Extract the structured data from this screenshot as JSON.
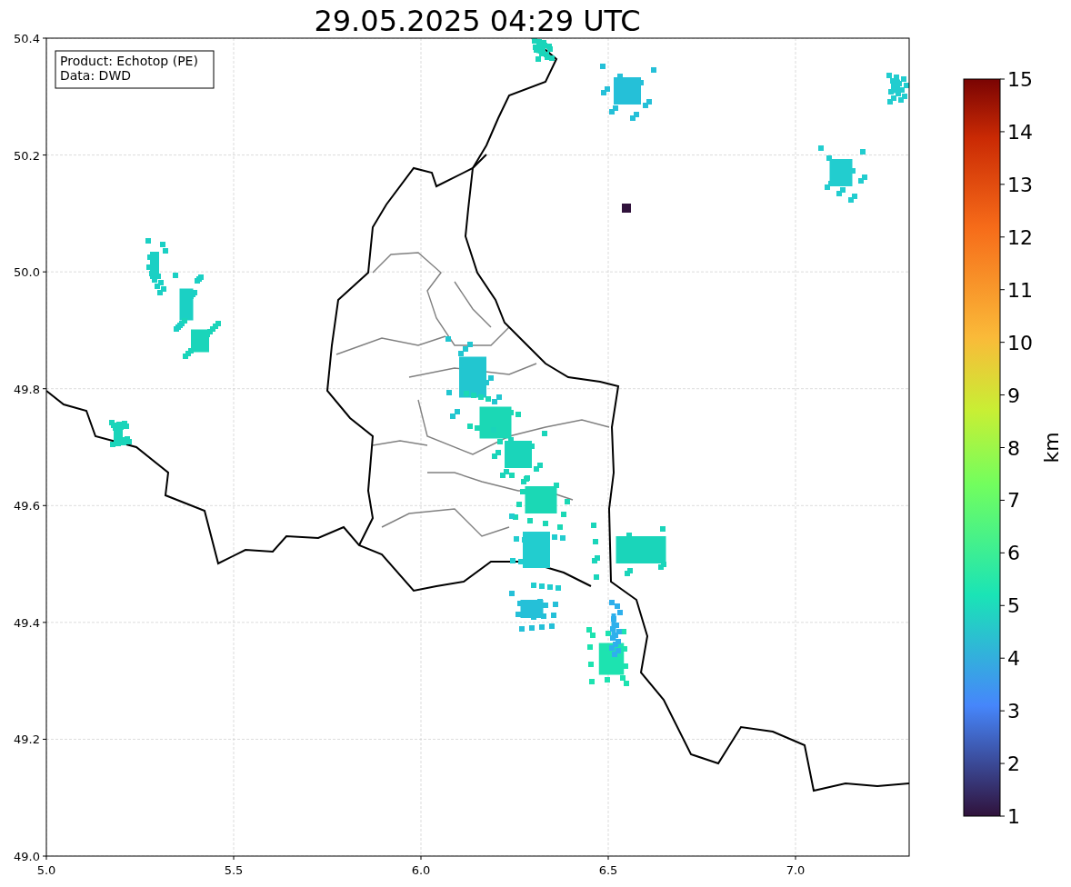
{
  "title": "29.05.2025 04:29 UTC",
  "info_box": [
    "Product: Echotop (PE)",
    "Data: DWD"
  ],
  "x_ticks": [
    "5.0",
    "5.5",
    "6.0",
    "6.5",
    "7.0"
  ],
  "y_ticks": [
    "50.4",
    "50.2",
    "50.0",
    "49.8",
    "49.6",
    "49.4",
    "49.2",
    "49.0"
  ],
  "colorbar": {
    "label": "km",
    "ticks": [
      "15",
      "14",
      "13",
      "12",
      "11",
      "10",
      "9",
      "8",
      "7",
      "6",
      "5",
      "4",
      "3",
      "2",
      "1"
    ]
  }
}
